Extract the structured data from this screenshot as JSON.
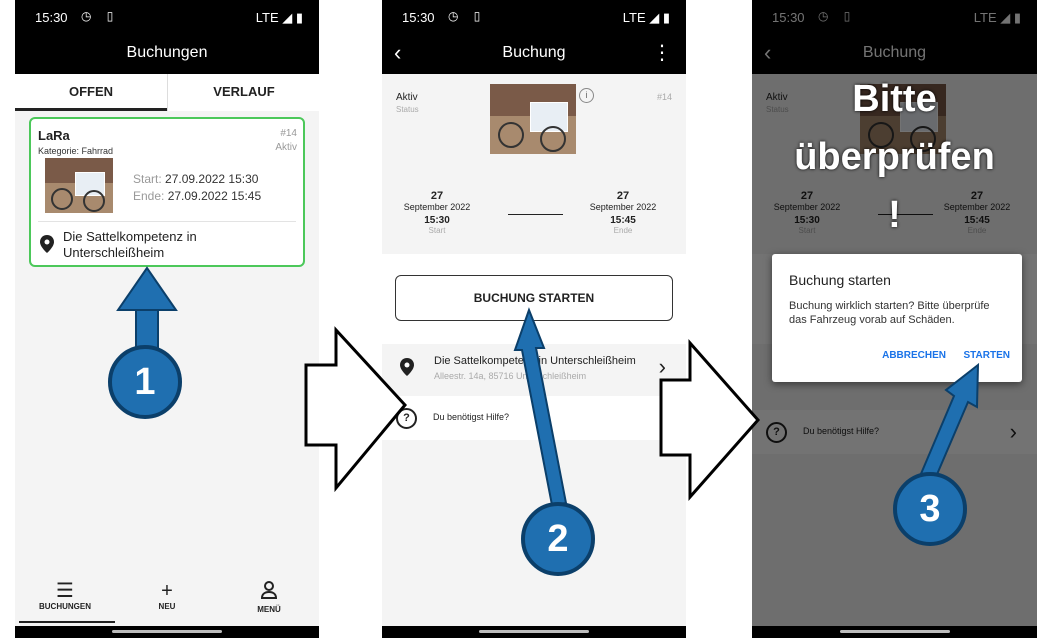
{
  "status": {
    "time": "15:30",
    "network": "LTE",
    "icons": [
      "alarm-icon",
      "sim-icon",
      "signal-icon",
      "battery-icon"
    ]
  },
  "screen1": {
    "title": "Buchungen",
    "tabs": [
      {
        "label": "OFFEN"
      },
      {
        "label": "VERLAUF"
      }
    ],
    "booking": {
      "name": "LaRa",
      "category": "Kategorie: Fahrrad",
      "number": "#14",
      "state": "Aktiv",
      "start_key": "Start:",
      "start_value": "27.09.2022 15:30",
      "end_key": "Ende:",
      "end_value": "27.09.2022 15:45",
      "location": "Die Sattelkompetenz in Unterschleißheim"
    },
    "bottom_nav": [
      {
        "label": "BUCHUNGEN",
        "icon": "list-icon"
      },
      {
        "label": "NEU",
        "icon": "plus-icon"
      },
      {
        "label": "MENÜ",
        "icon": "person-icon"
      }
    ]
  },
  "screen2": {
    "title": "Buchung",
    "status_value": "Aktiv",
    "status_label": "Status",
    "number": "#14",
    "start": {
      "day": "27",
      "month": "September 2022",
      "time": "15:30",
      "label": "Start"
    },
    "end": {
      "day": "27",
      "month": "September 2022",
      "time": "15:45",
      "label": "Ende"
    },
    "start_button": "BUCHUNG STARTEN",
    "location_name": "Die Sattelkompetenz in Unterschleißheim",
    "location_address": "Alleestr. 14a, 85716 Unterschleißheim",
    "help": "Du benötigst Hilfe?"
  },
  "screen3": {
    "overlay_text_line1": "Bitte",
    "overlay_text_line2": "überprüfen",
    "overlay_text_line3": "!",
    "dialog_title": "Buchung starten",
    "dialog_body": "Buchung wirklich starten? Bitte überprüfe das Fahrzeug vorab auf Schäden.",
    "dialog_cancel": "ABBRECHEN",
    "dialog_confirm": "STARTEN"
  },
  "steps": [
    "1",
    "2",
    "3"
  ],
  "colors": {
    "card_border": "#4cc85a",
    "accent_blue": "#1f6fb0",
    "dialog_button": "#1a73e8"
  }
}
